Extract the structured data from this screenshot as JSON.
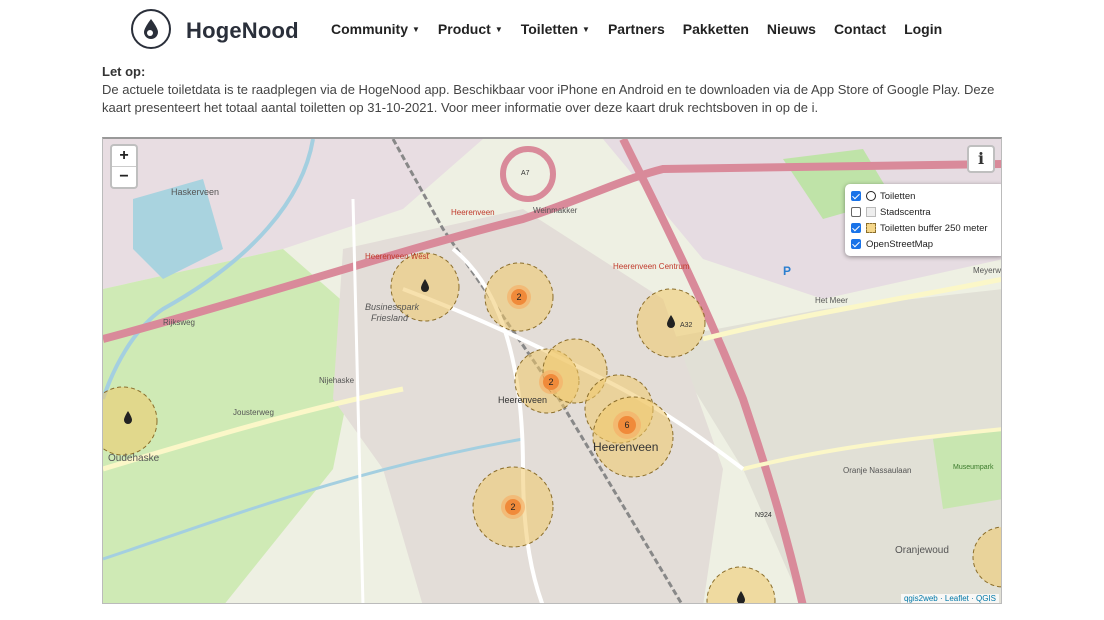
{
  "brand": {
    "name": "HogeNood"
  },
  "nav": [
    {
      "label": "Community",
      "dropdown": true
    },
    {
      "label": "Product",
      "dropdown": true
    },
    {
      "label": "Toiletten",
      "dropdown": true
    },
    {
      "label": "Partners",
      "dropdown": false
    },
    {
      "label": "Pakketten",
      "dropdown": false
    },
    {
      "label": "Nieuws",
      "dropdown": false
    },
    {
      "label": "Contact",
      "dropdown": false
    },
    {
      "label": "Login",
      "dropdown": false
    }
  ],
  "notice": {
    "title": "Let op:",
    "body": "De actuele toiletdata is te raadplegen via de HogeNood app. Beschikbaar voor iPhone en Android en te downloaden via de App Store of Google Play. Deze kaart presenteert het totaal aantal toiletten op 31-10-2021. Voor meer informatie over deze kaart druk rechtsboven in op de i."
  },
  "map": {
    "zoom_in": "+",
    "zoom_out": "−",
    "info": "i",
    "layers": [
      {
        "label": "Toiletten",
        "checked": true,
        "swatch": "drop"
      },
      {
        "label": "Stadscentra",
        "checked": false,
        "swatch": "city"
      },
      {
        "label": "Toiletten buffer 250 meter",
        "checked": true,
        "swatch": "buffer"
      },
      {
        "label": "OpenStreetMap",
        "checked": true,
        "swatch": "none"
      }
    ],
    "clusters": [
      "2",
      "2",
      "6",
      "2"
    ],
    "places": {
      "haskerveen": "Haskerveen",
      "heerenveen_west": "Heerenveen West",
      "businesspark": "Businesspark",
      "friesland": "Friesland",
      "heerenveen_small": "Heerenveen",
      "heerenveen_mid": "Heerenveen",
      "heerenveen_big": "Heerenveen",
      "heerenveen_centrum": "Heerenveen Centrum",
      "nijehaske": "Nijehaske",
      "oudehaske": "Oudehaske",
      "oranjewoud": "Oranjewoud",
      "museumpark": "Museumpark"
    },
    "roads": {
      "a7": "A7",
      "a32": "A32",
      "n924": "N924",
      "rijksweg": "Rijksweg",
      "jousterweg": "Jousterweg",
      "het_meer": "Het Meer",
      "oranje_nassaulaan": "Oranje Nassaulaan",
      "weinmakker": "Weinmakker",
      "meyerweg": "Meyerweg"
    },
    "parking": "P",
    "attribution": "qgis2web · Leaflet · QGIS"
  }
}
